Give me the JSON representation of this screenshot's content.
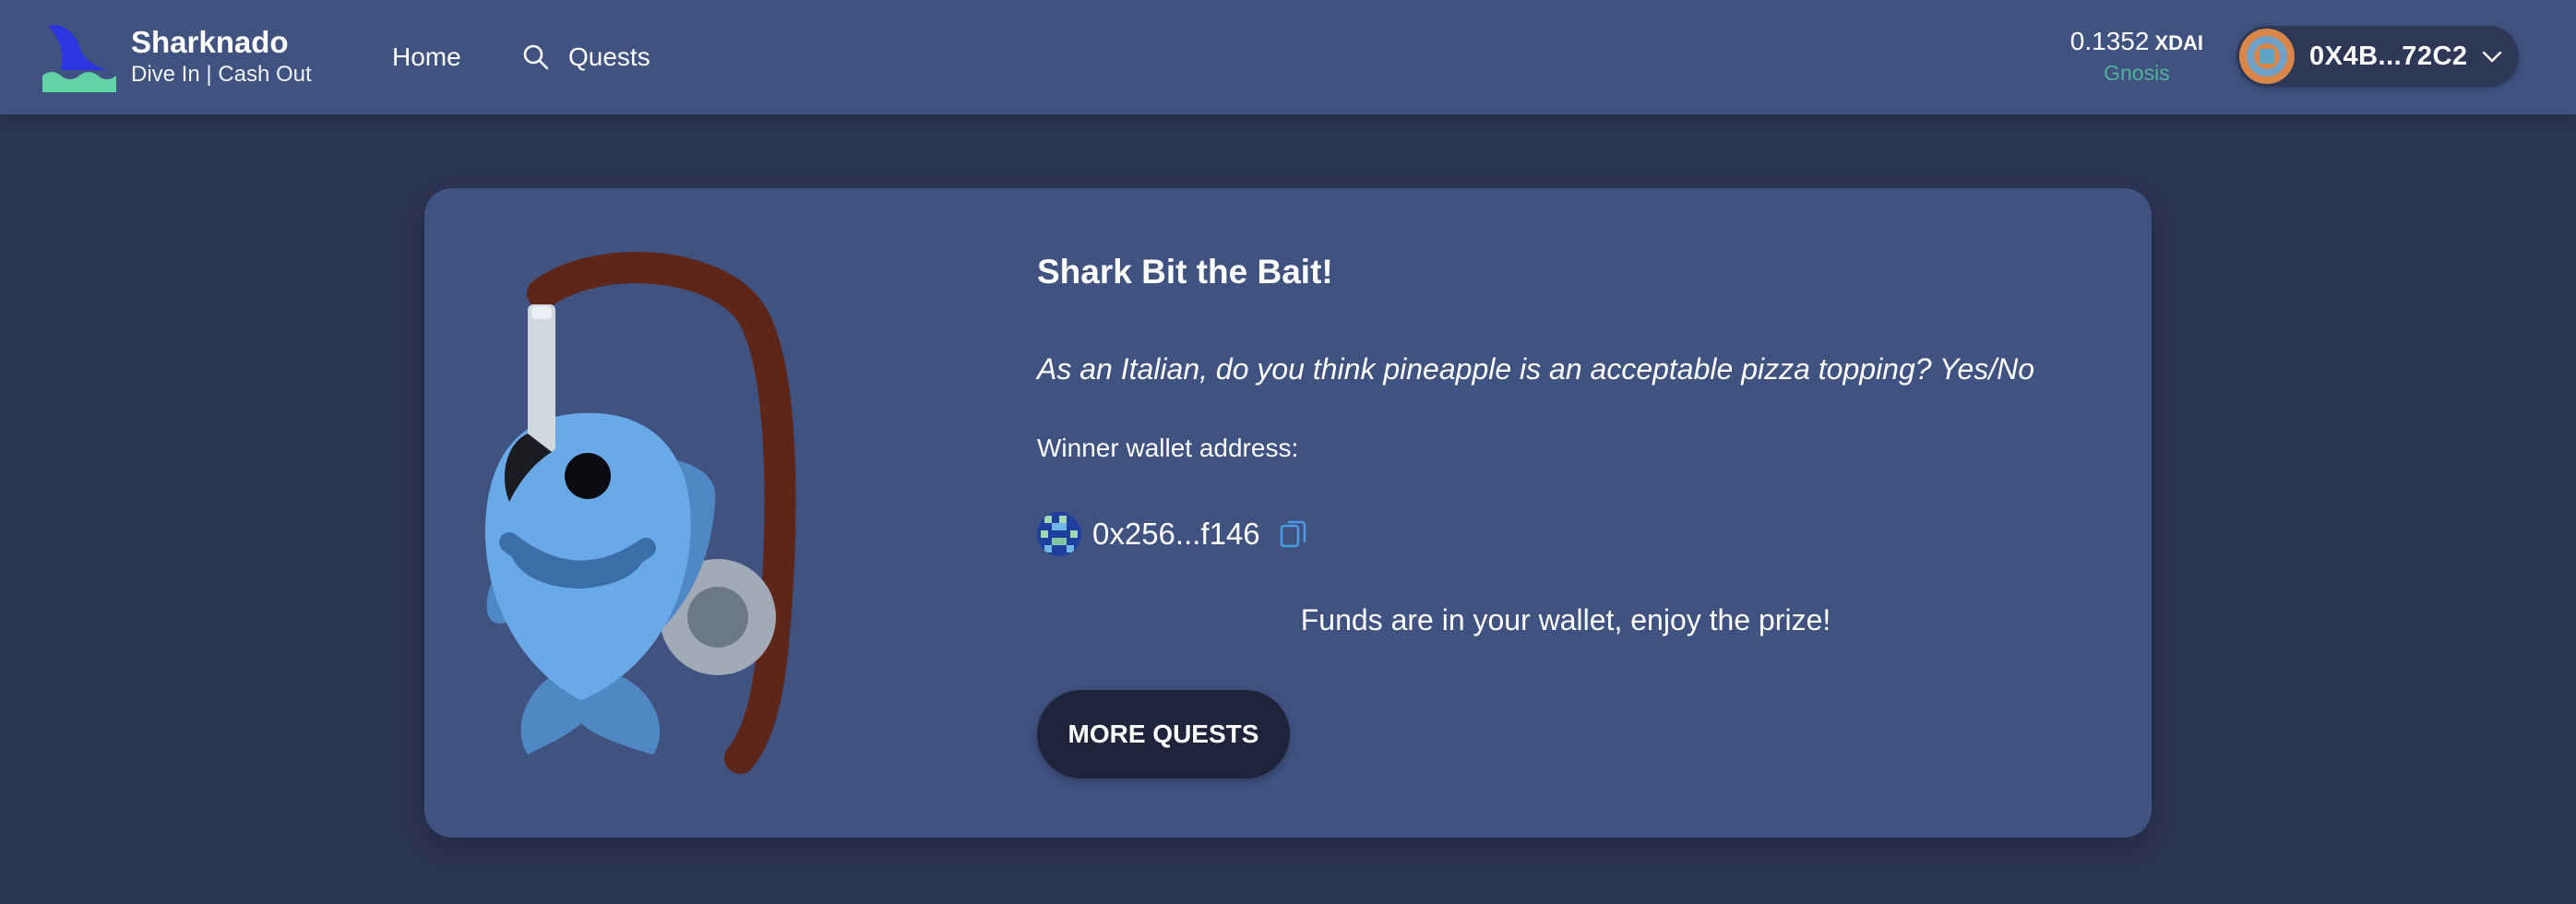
{
  "header": {
    "brand_title": "Sharknado",
    "brand_tagline": "Dive In | Cash Out",
    "nav": {
      "home": "Home",
      "quests": "Quests"
    },
    "balance": {
      "amount": "0.1352",
      "unit": "XDAI",
      "network": "Gnosis"
    },
    "account": {
      "address": "0X4B...72C2"
    }
  },
  "result": {
    "title": "Shark Bit the Bait!",
    "question": "As an Italian, do you think pineapple is an acceptable pizza topping? Yes/No",
    "winner_label": "Winner wallet address:",
    "winner_address": "0x256...f146",
    "message": "Funds are in your wallet, enjoy the prize!",
    "more_button": "MORE QUESTS"
  },
  "colors": {
    "page_bg": "#2d3554",
    "panel_bg": "#3f5280",
    "accent_green": "#52b39a",
    "button_bg": "#20243a",
    "copy_icon": "#4a9ae0"
  },
  "icons": [
    "shark-fin-logo",
    "search-icon",
    "chevron-down-icon",
    "copy-icon",
    "fish-on-hook-illustration"
  ]
}
